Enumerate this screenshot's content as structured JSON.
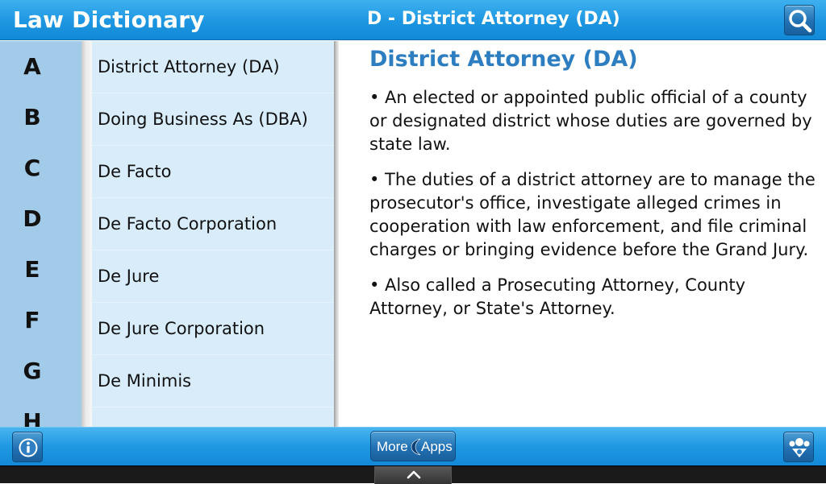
{
  "app": {
    "title": "Law Dictionary"
  },
  "header": {
    "current_entry": "D - District Attorney (DA)",
    "search_icon": "search-icon"
  },
  "alphabet_index": [
    "A",
    "B",
    "C",
    "D",
    "E",
    "F",
    "G",
    "H"
  ],
  "term_list": [
    "District Attorney (DA)",
    "Doing Business As (DBA)",
    "De Facto",
    "De Facto Corporation",
    "De Jure",
    "De Jure Corporation",
    "De Minimis"
  ],
  "definition": {
    "term": "District Attorney (DA)",
    "paragraphs": [
      "• An elected or appointed public official of a county or designated district whose duties are governed by state law.",
      "• The duties of a district attorney are to manage the prosecutor's office, investigate alleged crimes in cooperation with law enforcement, and file criminal charges or bringing evidence before the Grand Jury.",
      "• Also called a Prosecuting Attorney, County Attorney, or State's Attorney."
    ]
  },
  "bottom_bar": {
    "info_icon": "info-icon",
    "more_apps": {
      "more_label": "More",
      "apps_label": "Apps"
    },
    "share_icon": "share-icon"
  },
  "system_bar": {
    "home_icon": "chevron-up-icon"
  },
  "colors": {
    "bar_blue": "#1d96e1",
    "title_blue": "#2d7dc1",
    "alpha_bg": "#a2cbe9",
    "list_bg": "#d8ecfa"
  }
}
